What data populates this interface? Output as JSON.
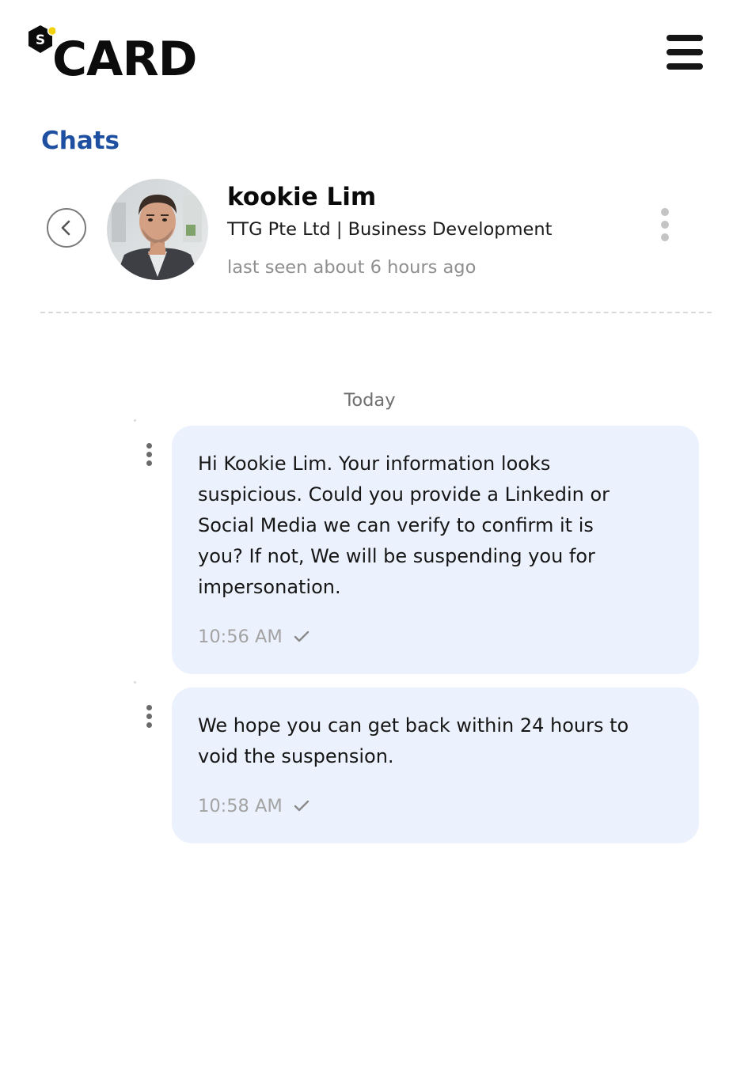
{
  "app": {
    "logo_badge": "S",
    "logo_text": "CARD"
  },
  "page": {
    "title": "Chats"
  },
  "contact": {
    "name": "kookie Lim",
    "company": "TTG Pte Ltd | Business Development",
    "status": "last seen about 6 hours ago"
  },
  "conversation": {
    "day_label": "Today",
    "messages": [
      {
        "text": "Hi Kookie Lim. Your information looks\nsuspicious. Could you provide a Linkedin or\nSocial Media we can verify to confirm it is\nyou? If not, We will be suspending you for\nimpersonation.",
        "time": "10:56 AM",
        "status": "sent"
      },
      {
        "text": "We hope you can get back within 24 hours to\nvoid the suspension.",
        "time": "10:58 AM",
        "status": "sent"
      }
    ]
  },
  "icons": {
    "menu": "hamburger-menu-icon",
    "back": "chevron-left-icon",
    "more": "more-vertical-icon",
    "check": "check-icon"
  },
  "colors": {
    "accent": "#1e4fa0",
    "bubble": "#ecf2fd",
    "logo_dot": "#f2d20f"
  }
}
